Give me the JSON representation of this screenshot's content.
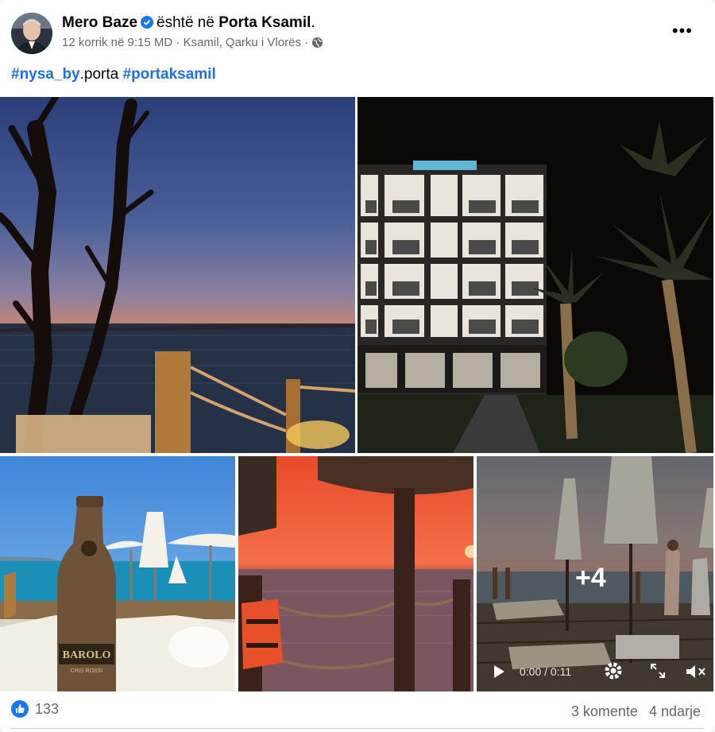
{
  "post": {
    "author": "Mero Baze",
    "is_at": "është në",
    "place": "Porta Ksamil",
    "period": ".",
    "date": "12 korrik në 9:15 MD",
    "sep": "·",
    "location": "Ksamil, Qarku i Vlorës",
    "sep2": "·",
    "more": "•••"
  },
  "caption": {
    "tag1": "#nysa_by",
    "text": ".porta",
    "tag2": "#portaksamil"
  },
  "gallery": {
    "overlay_count": "+4",
    "video_time": "0:00 / 0:11",
    "bottle_text1": "BAROLO",
    "bottle_text2": "CRIS ROSSI"
  },
  "footer": {
    "reaction_count": "133",
    "comments": "3 komente",
    "shares": "4 ndarje"
  },
  "colors": {
    "link": "#216fdb",
    "like": "#1877f2"
  },
  "icons": [
    "verified-badge-icon",
    "globe-icon",
    "more-options-icon",
    "like-reaction-icon",
    "play-icon",
    "settings-gear-icon",
    "expand-icon",
    "volume-icon"
  ]
}
